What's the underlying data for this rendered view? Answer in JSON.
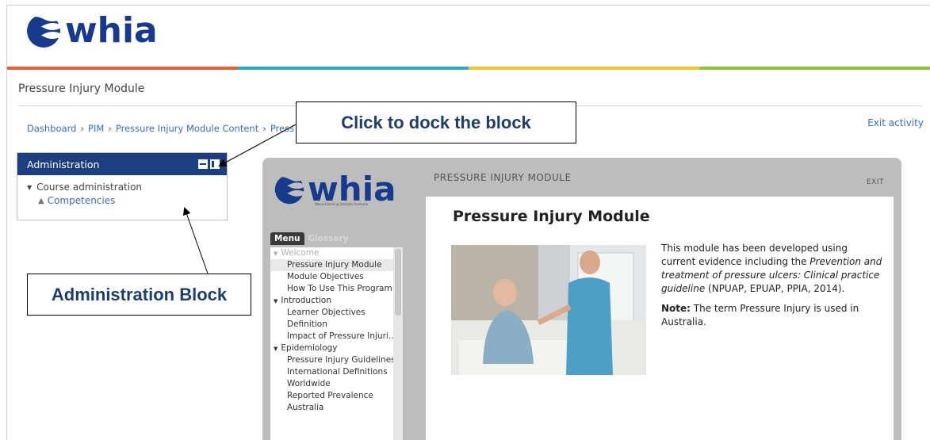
{
  "brand": {
    "logo_text": "whia",
    "logo_subtitle": "Wound Healing Institute Australia",
    "primary_color": "#183a8c"
  },
  "stripe_colors": [
    "#e0603a",
    "#2aa7c9",
    "#f2c230",
    "#8cc63f"
  ],
  "site": {
    "title": "Pressure Injury Module",
    "exit_activity": "Exit activity"
  },
  "breadcrumb": [
    "Dashboard",
    "PIM",
    "Pressure Injury Module Content",
    "Press"
  ],
  "admin_block": {
    "title": "Administration",
    "items": [
      {
        "label": "Course administration"
      },
      {
        "label": "Competencies"
      }
    ]
  },
  "callouts": {
    "dock": "Click to dock the block",
    "admin": "Administration Block"
  },
  "module": {
    "header": "PRESSURE INJURY MODULE",
    "exit": "EXIT",
    "tabs": [
      "Menu",
      "Glossary"
    ],
    "menu": [
      {
        "label": "Welcome",
        "type": "section"
      },
      {
        "label": "Pressure Injury Module",
        "type": "item"
      },
      {
        "label": "Module Objectives",
        "type": "item"
      },
      {
        "label": "How To Use This Program",
        "type": "item"
      },
      {
        "label": "Introduction",
        "type": "section"
      },
      {
        "label": "Learner Objectives",
        "type": "item"
      },
      {
        "label": "Definition",
        "type": "item"
      },
      {
        "label": "Impact of Pressure Injuri...",
        "type": "item"
      },
      {
        "label": "Epidemiology",
        "type": "section"
      },
      {
        "label": "Pressure Injury Guidelines",
        "type": "item"
      },
      {
        "label": "International Definitions",
        "type": "item"
      },
      {
        "label": "Worldwide",
        "type": "item"
      },
      {
        "label": "Reported Prevalence",
        "type": "item"
      },
      {
        "label": "Australia",
        "type": "item"
      }
    ],
    "content": {
      "title": "Pressure Injury Module",
      "para1_a": "This module has been developed using current evidence including the ",
      "para1_b": "Prevention and treatment of pressure ulcers: Clinical practice guideline",
      "para1_c": " (NPUAP, EPUAP, PPIA, 2014).",
      "note_label": "Note:",
      "note_text": " The term Pressure Injury is used in Australia."
    }
  }
}
